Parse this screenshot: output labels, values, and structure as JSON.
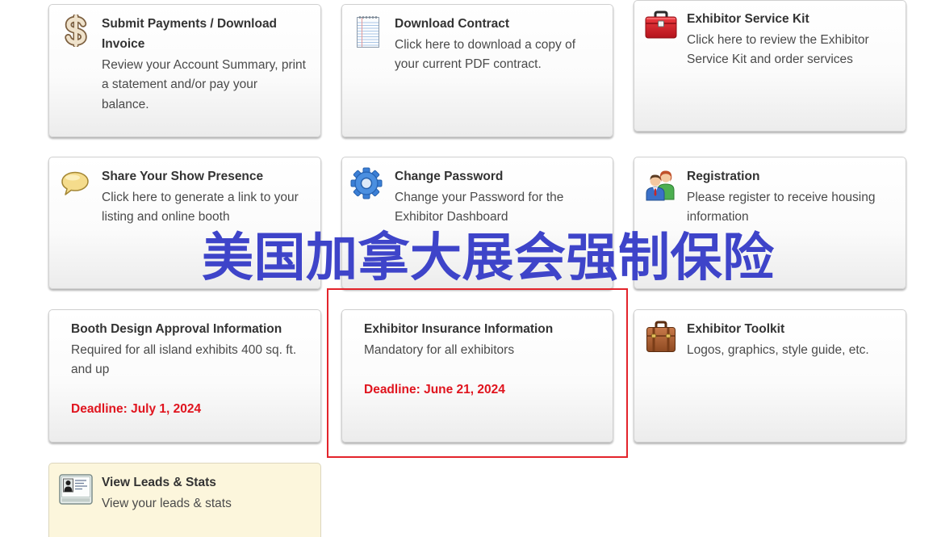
{
  "overlay_caption": "美国加拿大展会强制保险",
  "colors": {
    "overlay_text": "#3e44c9",
    "highlight_border": "#e3242b",
    "deadline": "#e0141e",
    "title_text": "#333333",
    "body_text": "#4a4a4a",
    "leads_tile_background": "#fcf6dc"
  },
  "cards": [
    {
      "icon": "dollar-sign-icon",
      "title_lines": [
        "Submit Payments / Download",
        "Invoice"
      ],
      "desc_lines": [
        "Review your Account Summary, print",
        "a statement and/or pay your",
        "balance."
      ]
    },
    {
      "icon": "document-icon",
      "title_lines": [
        "Download Contract"
      ],
      "desc_lines": [
        "Click here to download a copy of",
        "your current PDF contract."
      ]
    },
    {
      "icon": "toolbox-icon",
      "title_lines": [
        "Exhibitor Service Kit"
      ],
      "desc_lines": [
        "Click here to review the Exhibitor",
        "Service Kit and order services"
      ]
    },
    {
      "icon": "speech-bubble-icon",
      "title_lines": [
        "Share Your Show Presence"
      ],
      "desc_lines": [
        "Click here to generate a link to your",
        "listing and online booth"
      ]
    },
    {
      "icon": "gear-icon",
      "title_lines": [
        "Change Password"
      ],
      "desc_lines": [
        "Change your Password for the",
        "Exhibitor Dashboard"
      ]
    },
    {
      "icon": "people-icon",
      "title_lines": [
        "Registration"
      ],
      "desc_lines": [
        "Please register to receive housing",
        "information"
      ]
    },
    {
      "title_lines": [
        "Booth Design Approval Information"
      ],
      "desc_lines": [
        "Required for all island exhibits 400 sq. ft.",
        "and up"
      ],
      "deadline": "Deadline: July 1, 2024"
    },
    {
      "title_lines": [
        "Exhibitor Insurance Information"
      ],
      "desc_lines": [
        "Mandatory for all exhibitors"
      ],
      "deadline": "Deadline: June 21, 2024"
    },
    {
      "icon": "briefcase-icon",
      "title_lines": [
        "Exhibitor Toolkit"
      ],
      "desc_lines": [
        "Logos, graphics, style guide, etc."
      ]
    },
    {
      "icon": "id-card-icon",
      "title_lines": [
        "View Leads & Stats"
      ],
      "desc_lines": [
        "View your leads & stats"
      ]
    }
  ]
}
